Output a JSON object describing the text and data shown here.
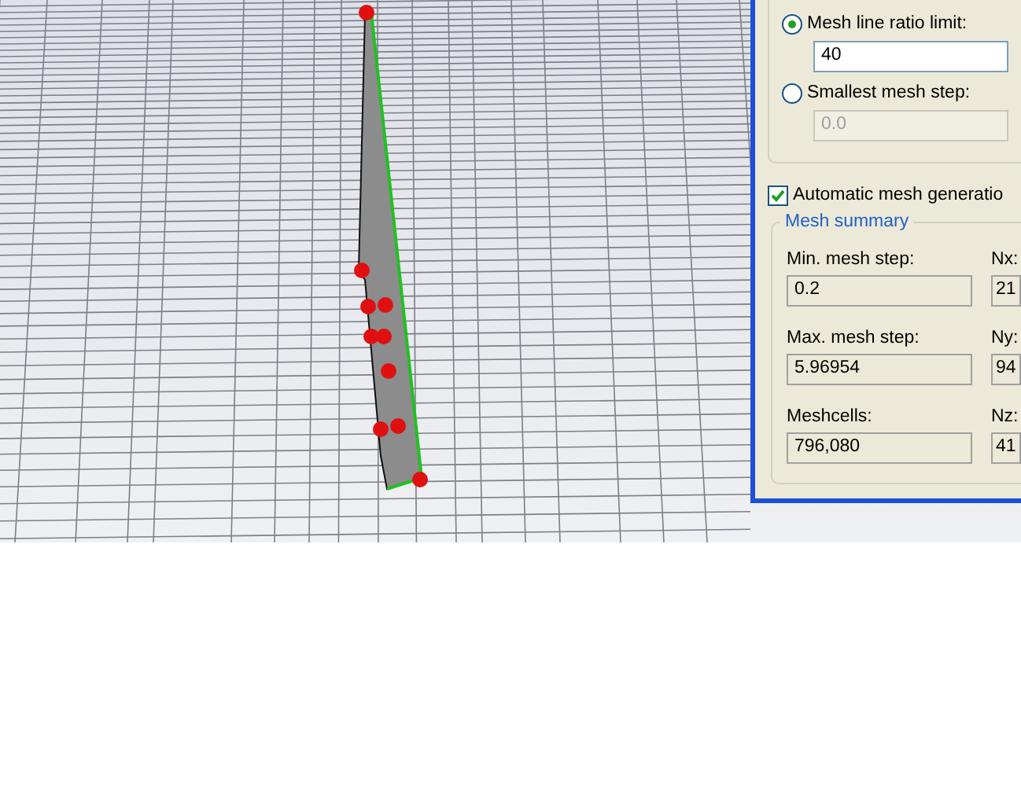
{
  "mesh_settings": {
    "options": [
      {
        "label": "Mesh line ratio limit:",
        "selected": true,
        "value": "40",
        "disabled": false
      },
      {
        "label": "Smallest mesh step:",
        "selected": false,
        "value": "0.0",
        "disabled": true
      }
    ]
  },
  "automatic_mesh": {
    "label": "Automatic mesh generatio",
    "checked": true
  },
  "mesh_summary": {
    "title": "Mesh summary",
    "rows": [
      {
        "label": "Min. mesh step:",
        "value": "0.2",
        "count_label": "Nx:",
        "count_value": "21"
      },
      {
        "label": "Max. mesh step:",
        "value": "5.96954",
        "count_label": "Ny:",
        "count_value": "94"
      },
      {
        "label": "Meshcells:",
        "value": "796,080",
        "count_label": "Nz:",
        "count_value": "41"
      }
    ]
  }
}
